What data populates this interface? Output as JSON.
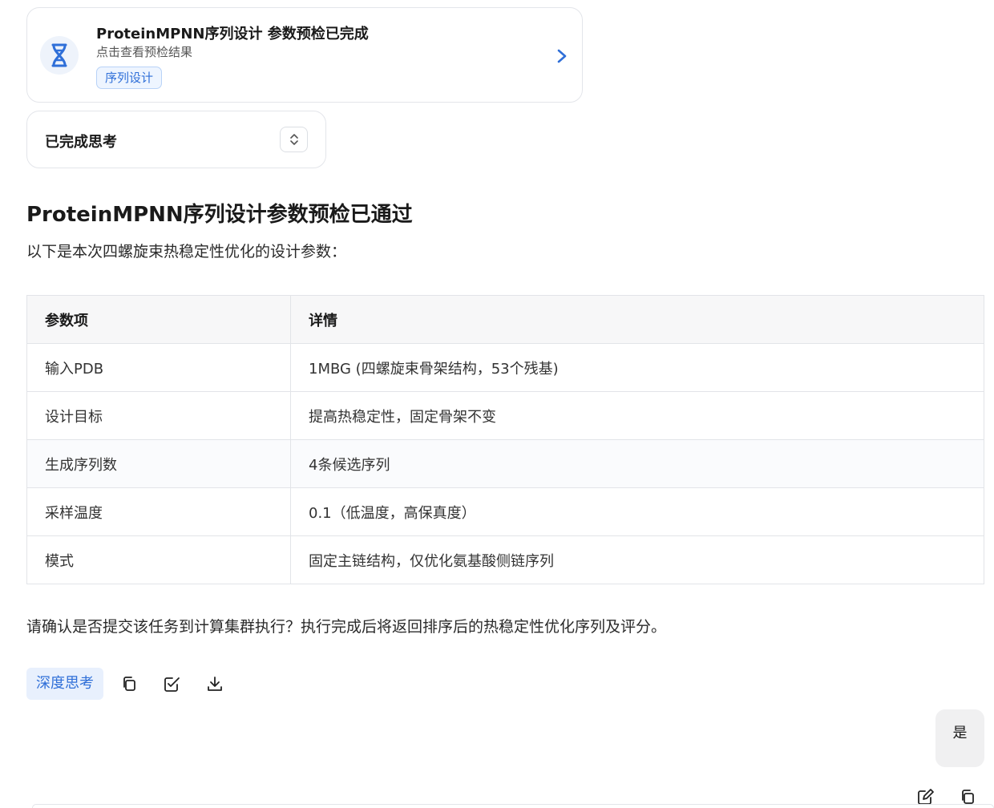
{
  "task_card": {
    "title": "ProteinMPNN序列设计 参数预检已完成",
    "subtitle": "点击查看预检结果",
    "tag": "序列设计",
    "icon": "dna-icon",
    "arrow_icon": "chevron-right-icon"
  },
  "thinking": {
    "label": "已完成思考",
    "toggle_icon": "expand-collapse-icon"
  },
  "message": {
    "heading": "ProteinMPNN序列设计参数预检已通过",
    "intro": "以下是本次四螺旋束热稳定性优化的设计参数：",
    "table": {
      "headers": [
        "参数项",
        "详情"
      ],
      "rows": [
        [
          "输入PDB",
          "1MBG (四螺旋束骨架结构，53个残基)"
        ],
        [
          "设计目标",
          "提高热稳定性，固定骨架不变"
        ],
        [
          "生成序列数",
          "4条候选序列"
        ],
        [
          "采样温度",
          "0.1（低温度，高保真度）"
        ],
        [
          "模式",
          "固定主链结构，仅优化氨基酸侧链序列"
        ]
      ]
    },
    "confirm": "请确认是否提交该任务到计算集群执行？执行完成后将返回排序后的热稳定性优化序列及评分。"
  },
  "actions": {
    "deep_think": "深度思考",
    "icons": [
      "copy-icon",
      "edit-note-icon",
      "download-icon"
    ]
  },
  "user_message": {
    "text": "是",
    "icons": [
      "edit-icon",
      "copy-icon"
    ]
  },
  "colors": {
    "accent": "#2f6fd8",
    "tag_bg": "#eef5ff",
    "deep_bg": "#e8f0fd",
    "bubble_bg": "#f0f0f1"
  }
}
